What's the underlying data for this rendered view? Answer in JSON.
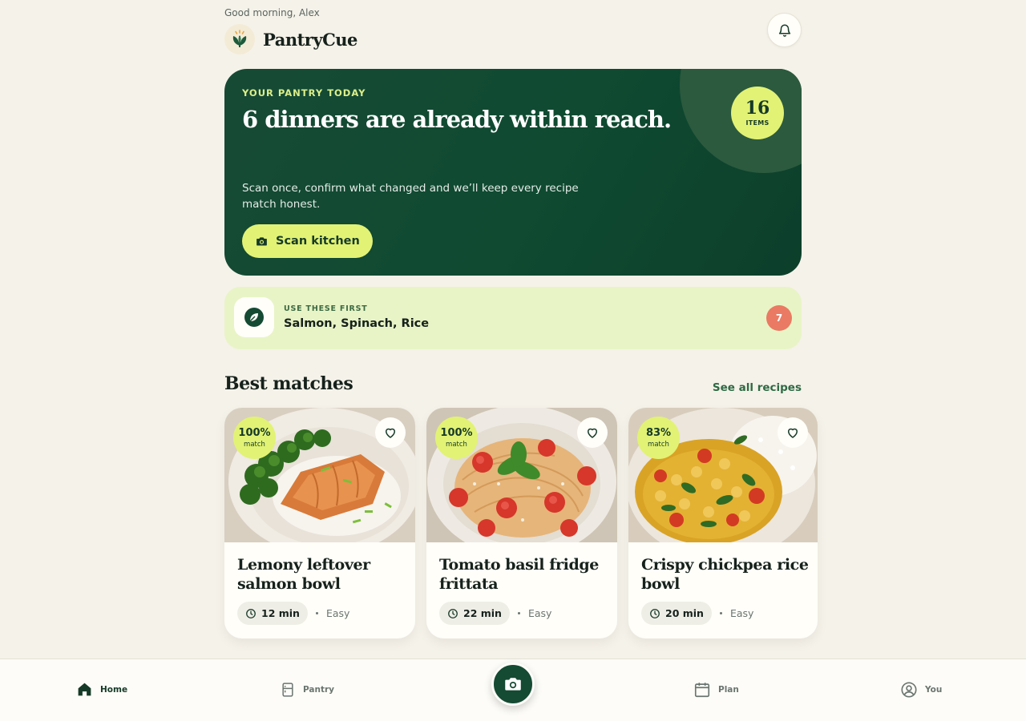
{
  "header": {
    "greeting": "Good morning, Alex",
    "app_name": "PantryCue",
    "notifications_icon": "bell-icon"
  },
  "hero": {
    "eyebrow": "YOUR PANTRY TODAY",
    "title": "6 dinners are already within reach.",
    "item_count": "16",
    "item_count_label": "ITEMS",
    "description": "Scan once, confirm what changed and we’ll keep every recipe match honest.",
    "scan_button_label": "Scan kitchen",
    "scan_button_icon": "camera-icon"
  },
  "use_first": {
    "eyebrow": "USE THESE FIRST",
    "items": "Salmon, Spinach, Rice",
    "count": "7",
    "icon": "leaf-icon"
  },
  "best_matches": {
    "title": "Best matches",
    "see_all_label": "See all recipes",
    "recipes": [
      {
        "match_pct": "100%",
        "match_label": "match",
        "title": "Lemony leftover salmon bowl",
        "time": "12 min",
        "difficulty": "Easy"
      },
      {
        "match_pct": "100%",
        "match_label": "match",
        "title": "Tomato basil fridge frittata",
        "time": "22 min",
        "difficulty": "Easy"
      },
      {
        "match_pct": "83%",
        "match_label": "match",
        "title": "Crispy chickpea rice bowl",
        "time": "20 min",
        "difficulty": "Easy"
      }
    ]
  },
  "nav": {
    "items": [
      {
        "label": "Home",
        "icon": "home-icon",
        "active": true
      },
      {
        "label": "Pantry",
        "icon": "fridge-icon",
        "active": false
      },
      {
        "label": "Plan",
        "icon": "calendar-icon",
        "active": false
      },
      {
        "label": "You",
        "icon": "user-icon",
        "active": false
      }
    ],
    "scan_fab_icon": "camera-icon"
  },
  "colors": {
    "background": "#f5f2e9",
    "primary_green": "#154a33",
    "accent_lime": "#e2f274",
    "alert_coral": "#ea7a63",
    "soft_green": "#e8f4c6"
  }
}
